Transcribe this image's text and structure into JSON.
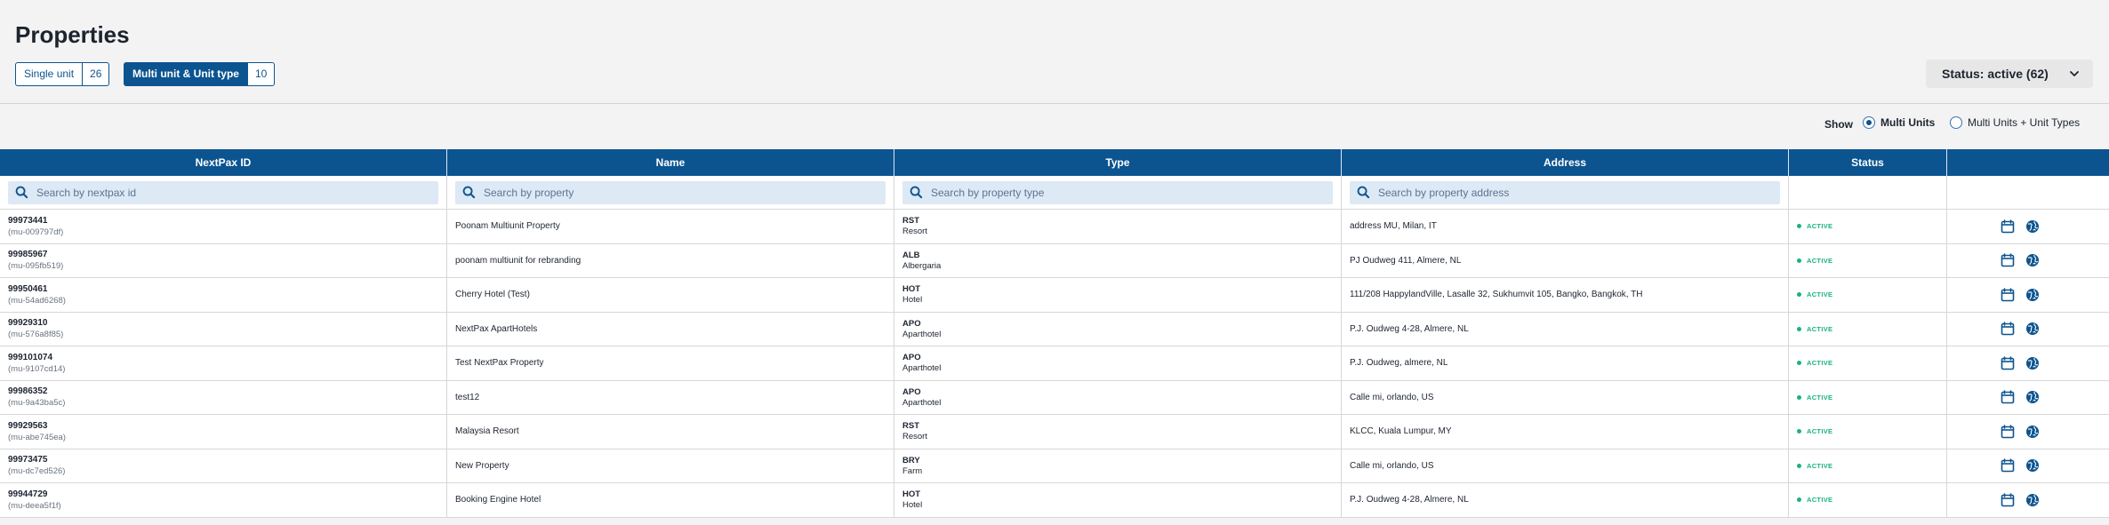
{
  "page": {
    "title": "Properties"
  },
  "filters": {
    "single": {
      "label": "Single unit",
      "count": "26"
    },
    "multi": {
      "label": "Multi unit & Unit type",
      "count": "10"
    },
    "status_dropdown": "Status: active (62)"
  },
  "show": {
    "label": "Show",
    "options": [
      "Multi Units",
      "Multi Units + Unit Types"
    ],
    "selected": "Multi Units"
  },
  "table": {
    "columns": [
      "NextPax ID",
      "Name",
      "Type",
      "Address",
      "Status",
      ""
    ],
    "search": {
      "id": "Search by nextpax id",
      "name": "Search by property",
      "type": "Search by property type",
      "address": "Search by property address"
    },
    "rows": [
      {
        "id": "99973441",
        "sub": "(mu-009797df)",
        "name": "Poonam Multiunit Property",
        "type_code": "RST",
        "type_name": "Resort",
        "address": "address MU, Milan, IT",
        "status": "ACTIVE"
      },
      {
        "id": "99985967",
        "sub": "(mu-095fb519)",
        "name": "poonam multiunit for rebranding",
        "type_code": "ALB",
        "type_name": "Albergaria",
        "address": "PJ Oudweg 411, Almere, NL",
        "status": "ACTIVE"
      },
      {
        "id": "99950461",
        "sub": "(mu-54ad6268)",
        "name": "Cherry Hotel (Test)",
        "type_code": "HOT",
        "type_name": "Hotel",
        "address": "111/208 HappylandVille, Lasalle 32, Sukhumvit 105, Bangko, Bangkok, TH",
        "status": "ACTIVE"
      },
      {
        "id": "99929310",
        "sub": "(mu-576a8f85)",
        "name": "NextPax ApartHotels",
        "type_code": "APO",
        "type_name": "Aparthotel",
        "address": "P.J. Oudweg 4-28, Almere, NL",
        "status": "ACTIVE"
      },
      {
        "id": "999101074",
        "sub": "(mu-9107cd14)",
        "name": "Test NextPax Property",
        "type_code": "APO",
        "type_name": "Aparthotel",
        "address": "P.J. Oudweg, almere, NL",
        "status": "ACTIVE"
      },
      {
        "id": "99986352",
        "sub": "(mu-9a43ba5c)",
        "name": "test12",
        "type_code": "APO",
        "type_name": "Aparthotel",
        "address": "Calle mi, orlando, US",
        "status": "ACTIVE"
      },
      {
        "id": "99929563",
        "sub": "(mu-abe745ea)",
        "name": "Malaysia Resort",
        "type_code": "RST",
        "type_name": "Resort",
        "address": "KLCC, Kuala Lumpur, MY",
        "status": "ACTIVE"
      },
      {
        "id": "99973475",
        "sub": "(mu-dc7ed526)",
        "name": "New Property",
        "type_code": "BRY",
        "type_name": "Farm",
        "address": "Calle mi, orlando, US",
        "status": "ACTIVE"
      },
      {
        "id": "99944729",
        "sub": "(mu-deea5f1f)",
        "name": "Booking Engine Hotel",
        "type_code": "HOT",
        "type_name": "Hotel",
        "address": "P.J. Oudweg 4-28, Almere, NL",
        "status": "ACTIVE"
      }
    ]
  },
  "colors": {
    "primary": "#0c5490",
    "active": "#19b37a",
    "search_bg": "#dde9f5"
  },
  "icons": {
    "search": "search-icon",
    "calendar": "calendar-icon",
    "globe": "globe-icon",
    "chevron": "chevron-down-icon"
  }
}
